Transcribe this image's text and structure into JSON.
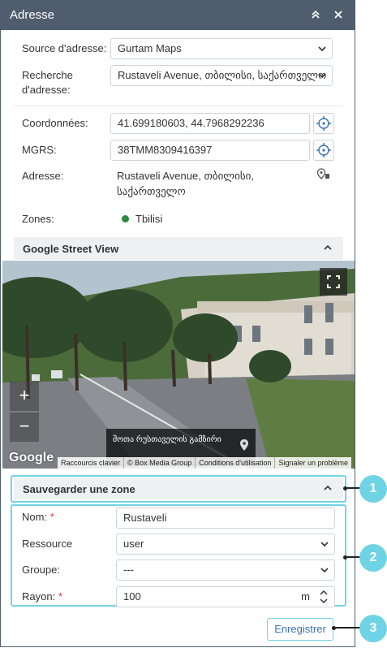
{
  "window": {
    "title": "Adresse"
  },
  "address": {
    "source_label": "Source d'adresse:",
    "source_value": "Gurtam Maps",
    "search_label_1": "Recherche",
    "search_label_2": "d'adresse:",
    "search_value": "Rustaveli Avenue, თბილისი, საქართველო",
    "coords_label": "Coordonnées:",
    "coords_value": "41.699180603, 44.7968292236",
    "mgrs_label": "MGRS:",
    "mgrs_value": "38TMM8309416397",
    "addr_label": "Adresse:",
    "addr_line1": "Rustaveli Avenue, თბილისი,",
    "addr_line2": "საქართველო",
    "zones_label": "Zones:",
    "zone_name": "Tbilisi",
    "zone_color": "#2e8b3d"
  },
  "street_view": {
    "header": "Google Street View",
    "caption": "შოთა რუსთაველის გამზირი",
    "logo": "Google",
    "footer": [
      "Raccourcis clavier",
      "© Box Media Group",
      "Conditions d'utilisation",
      "Signaler un problème"
    ]
  },
  "save_zone": {
    "header": "Sauvegarder une zone",
    "name_label": "Nom:",
    "name_value": "Rustaveli",
    "resource_label": "Ressource",
    "resource_value": "user",
    "group_label": "Groupe:",
    "group_value": "---",
    "radius_label": "Rayon:",
    "radius_value": "100",
    "radius_unit": "m",
    "required_mark": "*",
    "submit_label": "Enregistrer"
  },
  "callouts": [
    "1",
    "2",
    "3"
  ],
  "colors": {
    "titlebar": "#4f5d6e",
    "accent": "#3b74b8",
    "highlight": "#74d4e8",
    "callout": "#6fd3e6"
  }
}
